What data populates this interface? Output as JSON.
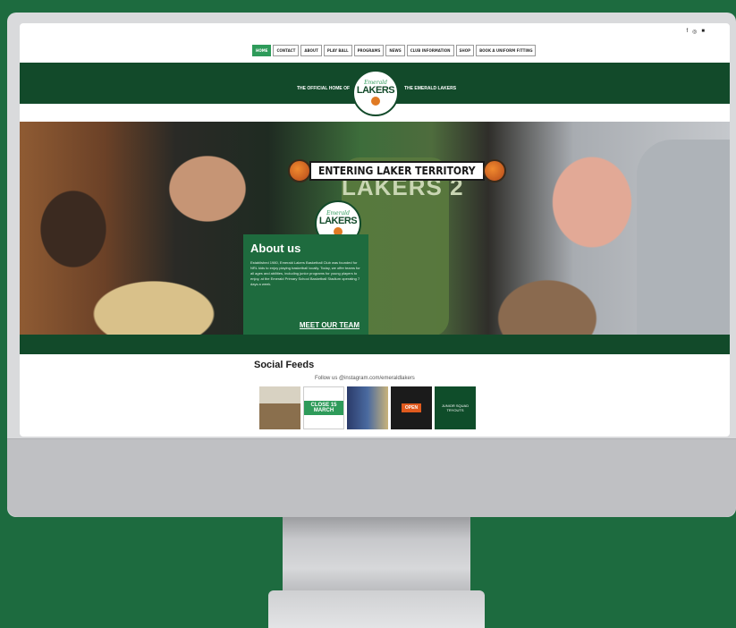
{
  "window": {
    "title": ""
  },
  "top_icons": [
    "facebook-icon",
    "instagram-icon",
    "cart-icon"
  ],
  "nav": {
    "items": [
      {
        "label": "HOME",
        "active": true
      },
      {
        "label": "CONTACT"
      },
      {
        "label": "ABOUT"
      },
      {
        "label": "PLAY BALL"
      },
      {
        "label": "PROGRAMS"
      },
      {
        "label": "NEWS"
      },
      {
        "label": "CLUB INFORMATION"
      },
      {
        "label": "SHOP"
      },
      {
        "label": "BOOK A UNIFORM FITTING"
      }
    ]
  },
  "banner": {
    "left_text": "THE OFFICIAL HOME OF",
    "right_text": "THE EMERALD LAKERS",
    "logo_script": "Emerald",
    "logo_word": "LAKERS"
  },
  "hero": {
    "headline": "ENTERING LAKER TERRITORY",
    "jersey_text": "LAKERS 2"
  },
  "about": {
    "title": "About us",
    "body": "Established 1980, Emerald Lakers Basketball Club was founded for NRL kids to enjoy playing basketball locally. Today, we offer teams for all ages and abilities, including junior programs for young players to enjoy, at the Emerald Primary School Basketball Stadium operating 7 days a week.",
    "link": "MEET OUR TEAM"
  },
  "social": {
    "heading": "Social Feeds",
    "follow": "Follow us @instagram.com/emeraldlakers",
    "posts": [
      {
        "label": ""
      },
      {
        "label": "CLOSE 15 MARCH"
      },
      {
        "label": ""
      },
      {
        "label": "OPEN"
      },
      {
        "label": "JUNIOR SQUAD TRYOUTS"
      }
    ]
  },
  "colors": {
    "page_bg": "#1d6b3f",
    "banner": "#124a2a",
    "accent": "#2e9b5a",
    "about_panel": "#1e6b3e"
  }
}
